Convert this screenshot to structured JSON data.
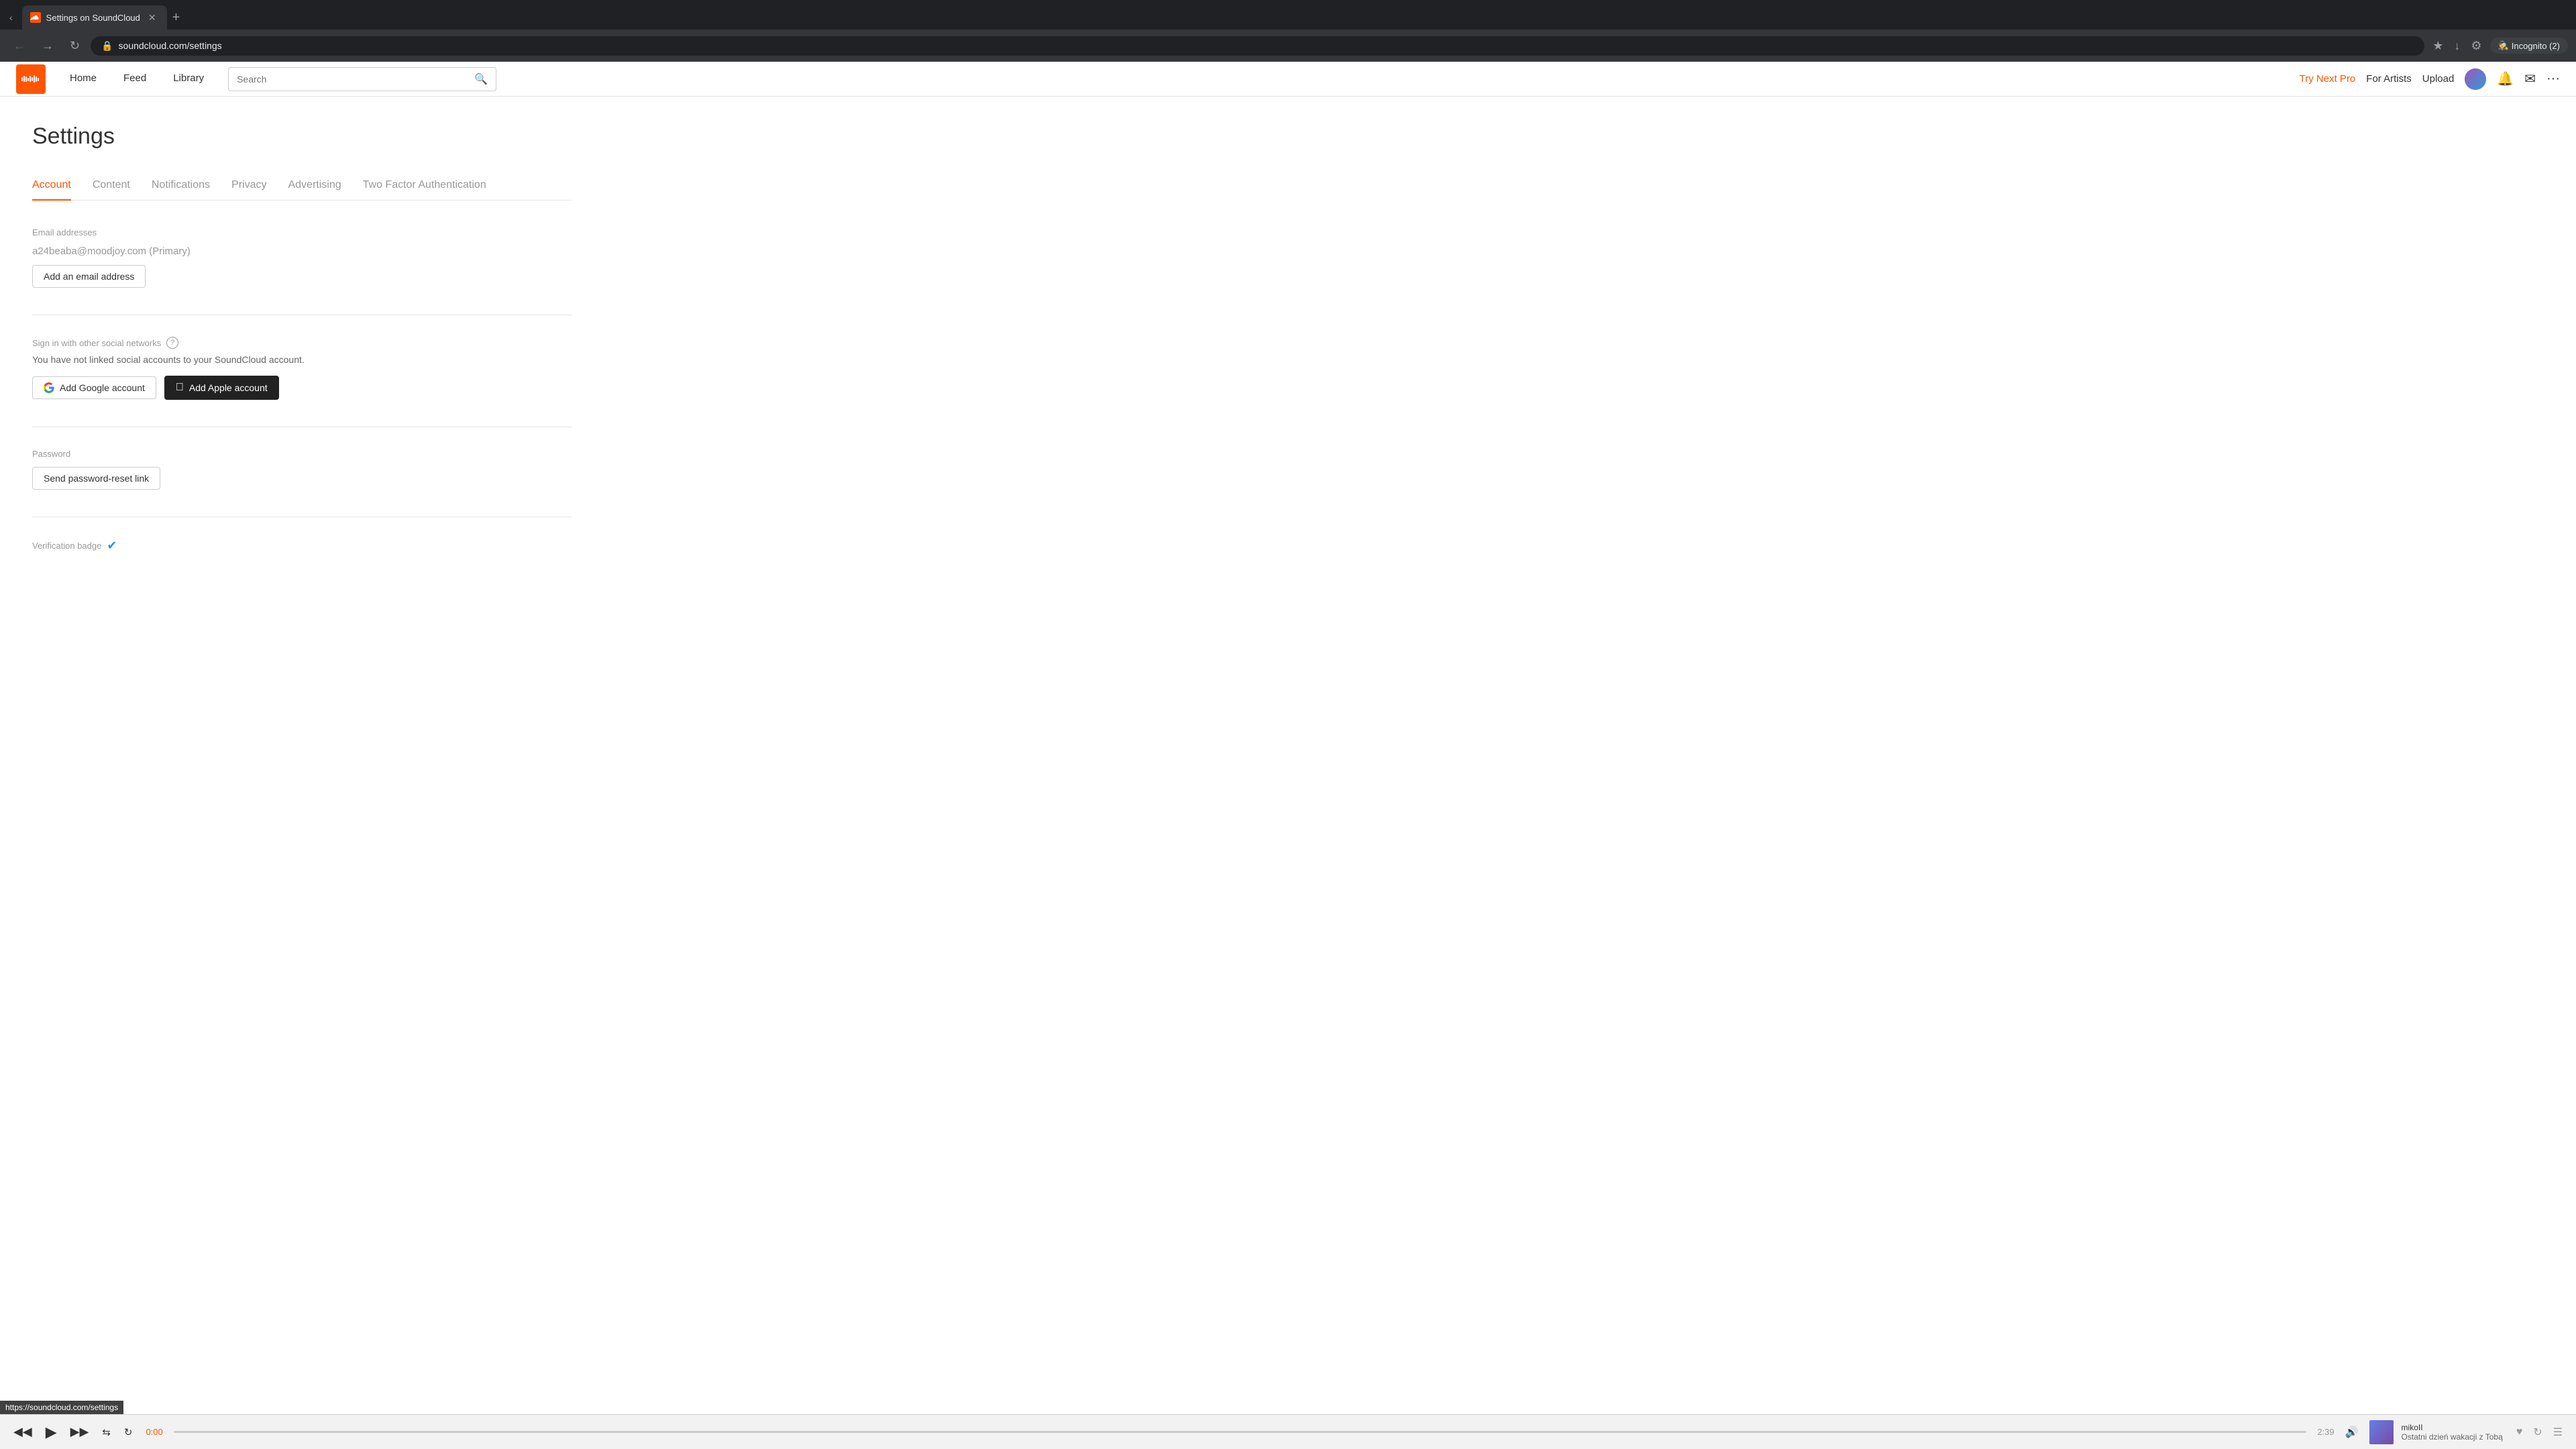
{
  "browser": {
    "tab_title": "Settings on SoundCloud",
    "url": "soundcloud.com/settings",
    "incognito_label": "Incognito (2)",
    "new_tab_label": "+"
  },
  "header": {
    "logo_alt": "SoundCloud",
    "nav": {
      "home": "Home",
      "feed": "Feed",
      "library": "Library"
    },
    "search_placeholder": "Search",
    "try_next_pro": "Try Next Pro",
    "for_artists": "For Artists",
    "upload": "Upload"
  },
  "settings": {
    "title": "Settings",
    "tabs": [
      {
        "id": "account",
        "label": "Account",
        "active": true
      },
      {
        "id": "content",
        "label": "Content",
        "active": false
      },
      {
        "id": "notifications",
        "label": "Notifications",
        "active": false
      },
      {
        "id": "privacy",
        "label": "Privacy",
        "active": false
      },
      {
        "id": "advertising",
        "label": "Advertising",
        "active": false
      },
      {
        "id": "two-factor",
        "label": "Two Factor Authentication",
        "active": false
      }
    ],
    "email_section": {
      "label": "Email addresses",
      "primary_email": "a24beaba@moodjoy.com",
      "primary_label": "(Primary)",
      "add_email_btn": "Add an email address"
    },
    "social_section": {
      "title": "Sign in with other social networks",
      "description": "You have not linked social accounts to your SoundCloud account.",
      "add_google_btn": "Add Google account",
      "add_apple_btn": "Add Apple account"
    },
    "password_section": {
      "label": "Password",
      "reset_btn": "Send password-reset link"
    },
    "verification_section": {
      "label": "Verification badge"
    }
  },
  "player": {
    "time_current": "0:00",
    "time_total": "2:39",
    "artist": "mikoII",
    "track": "Ostatni dzień wakacji z Tobą"
  },
  "status_bar": {
    "url": "https://soundcloud.com/settings"
  },
  "colors": {
    "accent": "#ff5500",
    "accent_text": "#ff5500"
  }
}
